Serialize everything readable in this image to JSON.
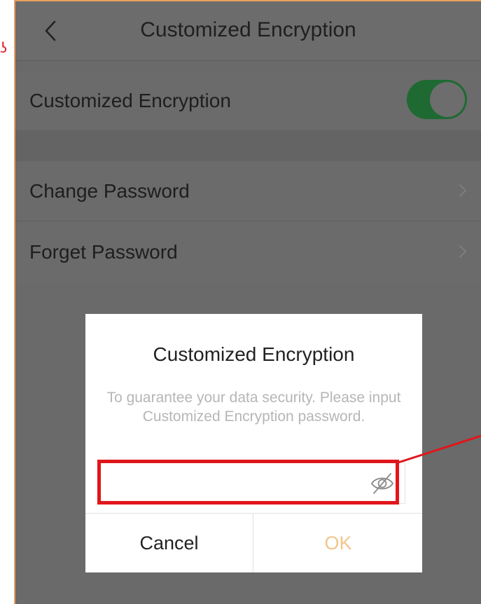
{
  "annotation": {
    "left_mark": "ʖ",
    "highlight_color": "#e0161b"
  },
  "navbar": {
    "title": "Customized Encryption",
    "back_icon": "chevron-left-icon"
  },
  "settings": {
    "encryption_label": "Customized Encryption",
    "encryption_enabled": true,
    "change_password_label": "Change Password",
    "forget_password_label": "Forget Password"
  },
  "dialog": {
    "title": "Customized Encryption",
    "message": "To guarantee your data security. Please input Customized Encryption password.",
    "password_value": "",
    "password_placeholder": "",
    "eye_icon": "eye-off-icon",
    "cancel_label": "Cancel",
    "ok_label": "OK"
  },
  "colors": {
    "toggle_on": "#1e6a32",
    "ok_text": "#f3c58a",
    "overlay": "#6a6a6a"
  }
}
